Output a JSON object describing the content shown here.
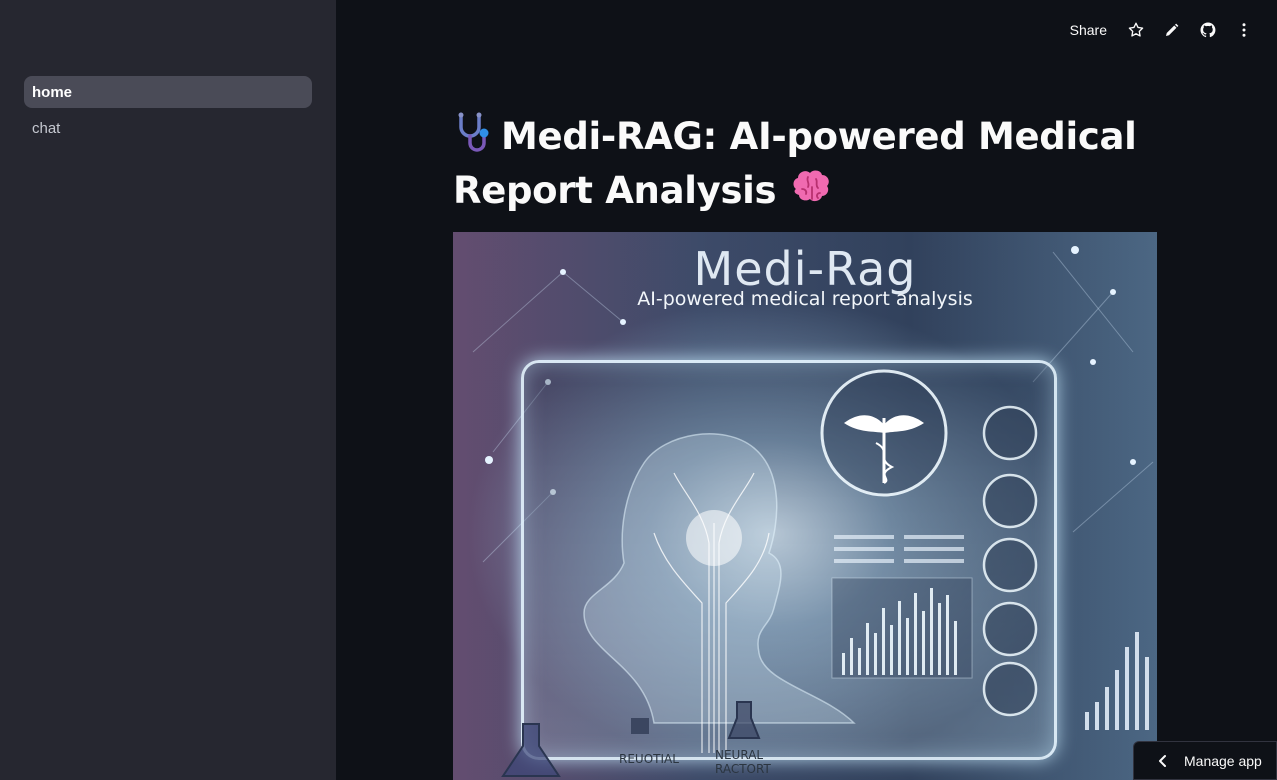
{
  "sidebar": {
    "items": [
      {
        "label": "home",
        "active": true
      },
      {
        "label": "chat",
        "active": false
      }
    ]
  },
  "toolbar": {
    "share_label": "Share",
    "icons": [
      "star-icon",
      "edit-icon",
      "github-icon",
      "more-vertical-icon"
    ]
  },
  "main": {
    "title": "Medi-RAG: AI-powered Medical Report Analysis",
    "title_prefix_icon": "stethoscope-icon",
    "title_suffix_icon": "brain-icon"
  },
  "hero_image": {
    "title": "Medi-Rag",
    "subtitle": "AI-powered medical report analysis",
    "label_left": "REUOTIAL",
    "label_right": "NEURAL RACTORT"
  },
  "footer": {
    "manage_app_label": "Manage app"
  },
  "colors": {
    "background": "#0e1117",
    "sidebar": "#262730",
    "active_nav": "#4a4b57",
    "text": "#fafafa"
  }
}
